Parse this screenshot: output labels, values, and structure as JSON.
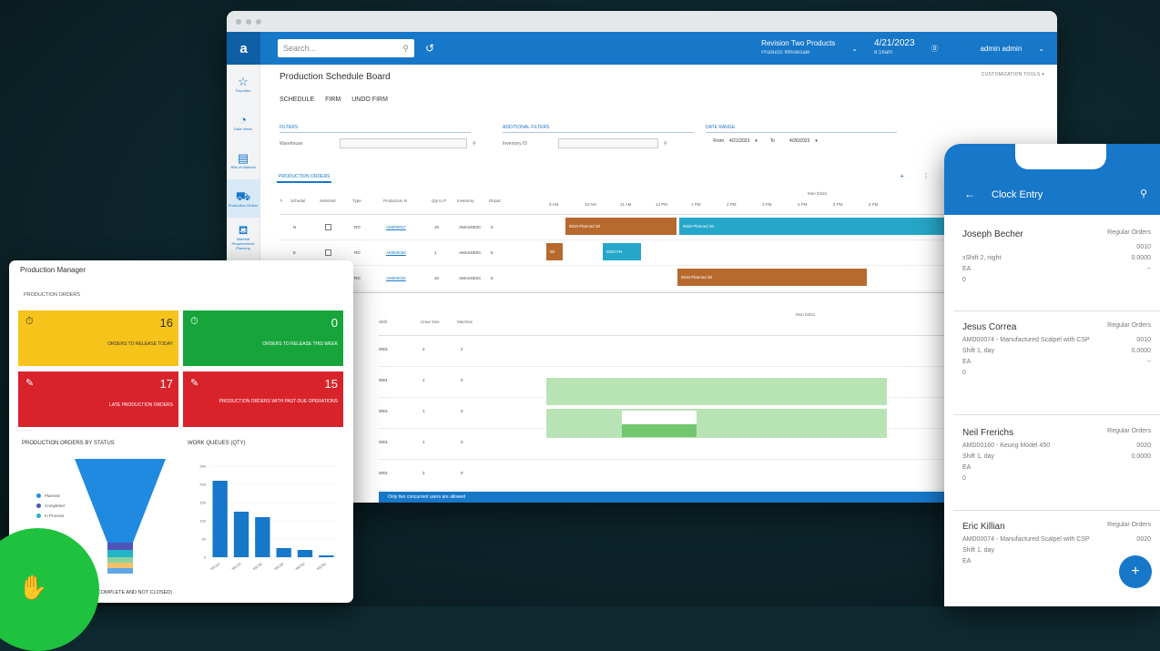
{
  "main_window": {
    "search_placeholder": "Search...",
    "company": "Revision Two Products",
    "company_sub": "Products Wholesale",
    "date": "4/21/2023",
    "date_sub": "8:16am",
    "user": "admin admin",
    "page_title": "Production Schedule Board",
    "top_links": "CUSTOMIZATION   TOOLS ▾",
    "actions": [
      "SCHEDULE",
      "FIRM",
      "UNDO FIRM"
    ],
    "sidebar": [
      "Favorites",
      "Data Views",
      "Bills of Material",
      "Production Orders",
      "Material Requirements Planning"
    ],
    "filters": {
      "filters_head": "FILTERS",
      "warehouse_label": "Warehouse",
      "addl_head": "ADDITIONAL FILTERS",
      "inventory_label": "Inventory ID",
      "date_head": "DATE RANGE",
      "from_label": "From",
      "from_value": "4/21/2023",
      "to_label": "To",
      "to_value": "4/26/2023"
    },
    "tab": "PRODUCTION ORDERS",
    "columns": [
      "Schedul",
      "Selected",
      "Type",
      "Production N",
      "Qty to P",
      "Inventory",
      "Dispat"
    ],
    "times": [
      "9 AM",
      "10 AM",
      "11 AM",
      "12 PM",
      "1 PM",
      "2 PM",
      "3 PM",
      "4 PM",
      "5 PM",
      "6 PM"
    ],
    "date_header": "Mon 04/21",
    "rows": [
      {
        "s": "N",
        "type": "RO",
        "order": "AM000027",
        "qty": "10",
        "inv": "AMASSE0C",
        "d": "5"
      },
      {
        "s": "E",
        "type": "RO",
        "order": "AM000033",
        "qty": "1",
        "inv": "AMASSE0C",
        "d": "5"
      },
      {
        "s": "N",
        "type": "RO",
        "order": "AM000032",
        "qty": "10",
        "inv": "AMASSE0C",
        "d": "5"
      }
    ],
    "bars": [
      "0010 Planned 30",
      "0020 Planned 30",
      "00",
      "0020 FN",
      "0010 Planned 30"
    ],
    "lower_columns": [
      "Shift",
      "Crew Size",
      "Machine"
    ],
    "lower_rows": [
      {
        "shift": "0001",
        "crew": "2",
        "mach": "2"
      },
      {
        "shift": "0001",
        "crew": "1",
        "mach": "0"
      },
      {
        "shift": "0001",
        "crew": "1",
        "mach": "0"
      },
      {
        "shift": "0001",
        "crew": "1",
        "mach": "0"
      },
      {
        "shift": "0001",
        "crew": "2",
        "mach": "0"
      }
    ],
    "status": "Only two concurrent users are allowed"
  },
  "pm": {
    "title": "Production Manager",
    "sub": "PRODUCTION ORDERS",
    "tiles": [
      {
        "num": "16",
        "label": "ORDERS TO RELEASE TODAY"
      },
      {
        "num": "0",
        "label": "ORDERS TO RELEASE THIS WEEK"
      },
      {
        "num": "17",
        "label": "LATE PRODUCTION ORDERS"
      },
      {
        "num": "15",
        "label": "PRODUCTION ORDERS WITH PAST-DUE OPERATIONS"
      }
    ],
    "funnel_title": "PRODUCTION ORDERS BY STATUS",
    "queue_title": "WORK QUEUES (QTY)",
    "legend": [
      "Planned",
      "Completed",
      "In Process"
    ],
    "footer": "Y (COMPLETE AND NOT CLOSED)"
  },
  "chart_data": {
    "type": "bar",
    "title": "WORK QUEUES (QTY)",
    "ylim": [
      0,
      250
    ],
    "yticks": [
      "250",
      "200",
      "150",
      "100",
      "50",
      "0"
    ],
    "categories": [
      "WC10",
      "WC20",
      "WC30",
      "WC40",
      "WC50",
      "WC60"
    ],
    "values": [
      210,
      125,
      110,
      25,
      20,
      5
    ],
    "color": "#1777c9"
  },
  "phone": {
    "title": "Clock Entry",
    "entries": [
      {
        "name": "Joseph Becher",
        "tag": "Regular Orders",
        "item": "",
        "num": "0010",
        "shift": "xShift 2, night",
        "val": "0.0000",
        "uom": "EA",
        "dash": "--",
        "zero": "0"
      },
      {
        "name": "Jesus Correa",
        "tag": "Regular Orders",
        "item": "AMD00074 - Manufactured Scalpel with CSP",
        "num": "0010",
        "shift": "Shift 1, day",
        "val": "0.0000",
        "uom": "EA",
        "dash": "--",
        "zero": "0"
      },
      {
        "name": "Neil Frerichs",
        "tag": "Regular Orders",
        "item": "AMD00160 - Keurig Model 450",
        "num": "0020",
        "shift": "Shift 1, day",
        "val": "0.0000",
        "uom": "EA",
        "dash": "",
        "zero": "0"
      },
      {
        "name": "Eric Killian",
        "tag": "Regular Orders",
        "item": "AMD00074 - Manufactured Scalpel with CSP",
        "num": "0020",
        "shift": "Shift 1, day",
        "val": "",
        "uom": "EA",
        "dash": "",
        "zero": ""
      }
    ],
    "fab": "+"
  }
}
